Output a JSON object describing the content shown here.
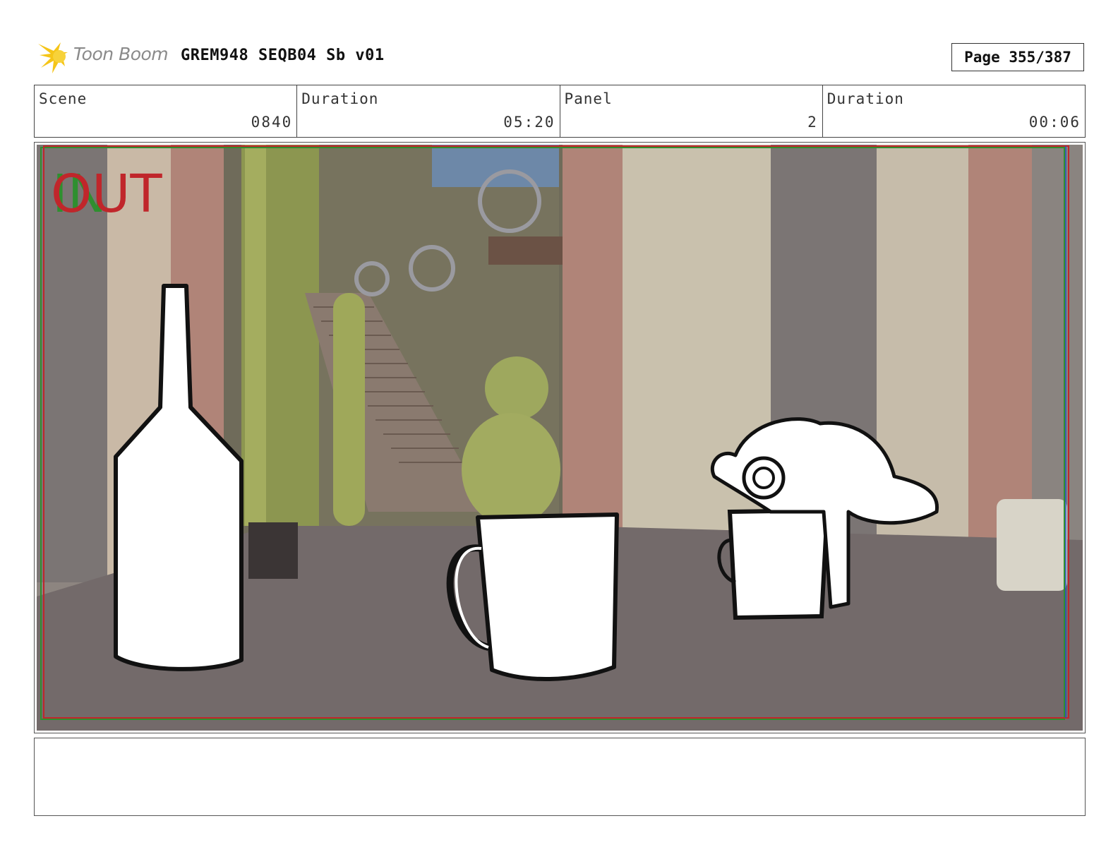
{
  "header": {
    "logo_text": "Toon Boom",
    "project_title": "GREM948 SEQB04 Sb v01",
    "page_label": "Page 355/387"
  },
  "info": [
    {
      "label": "Scene",
      "value": "0840"
    },
    {
      "label": "Duration",
      "value": "05:20"
    },
    {
      "label": "Panel",
      "value": "2"
    },
    {
      "label": "Duration",
      "value": "00:06"
    }
  ],
  "panel": {
    "overlay_text_in": "IN",
    "overlay_text_out": "OUT",
    "colors": {
      "frame_red": "#c0262b",
      "frame_green": "#2f8f2f"
    }
  },
  "notes": {
    "text": ""
  }
}
